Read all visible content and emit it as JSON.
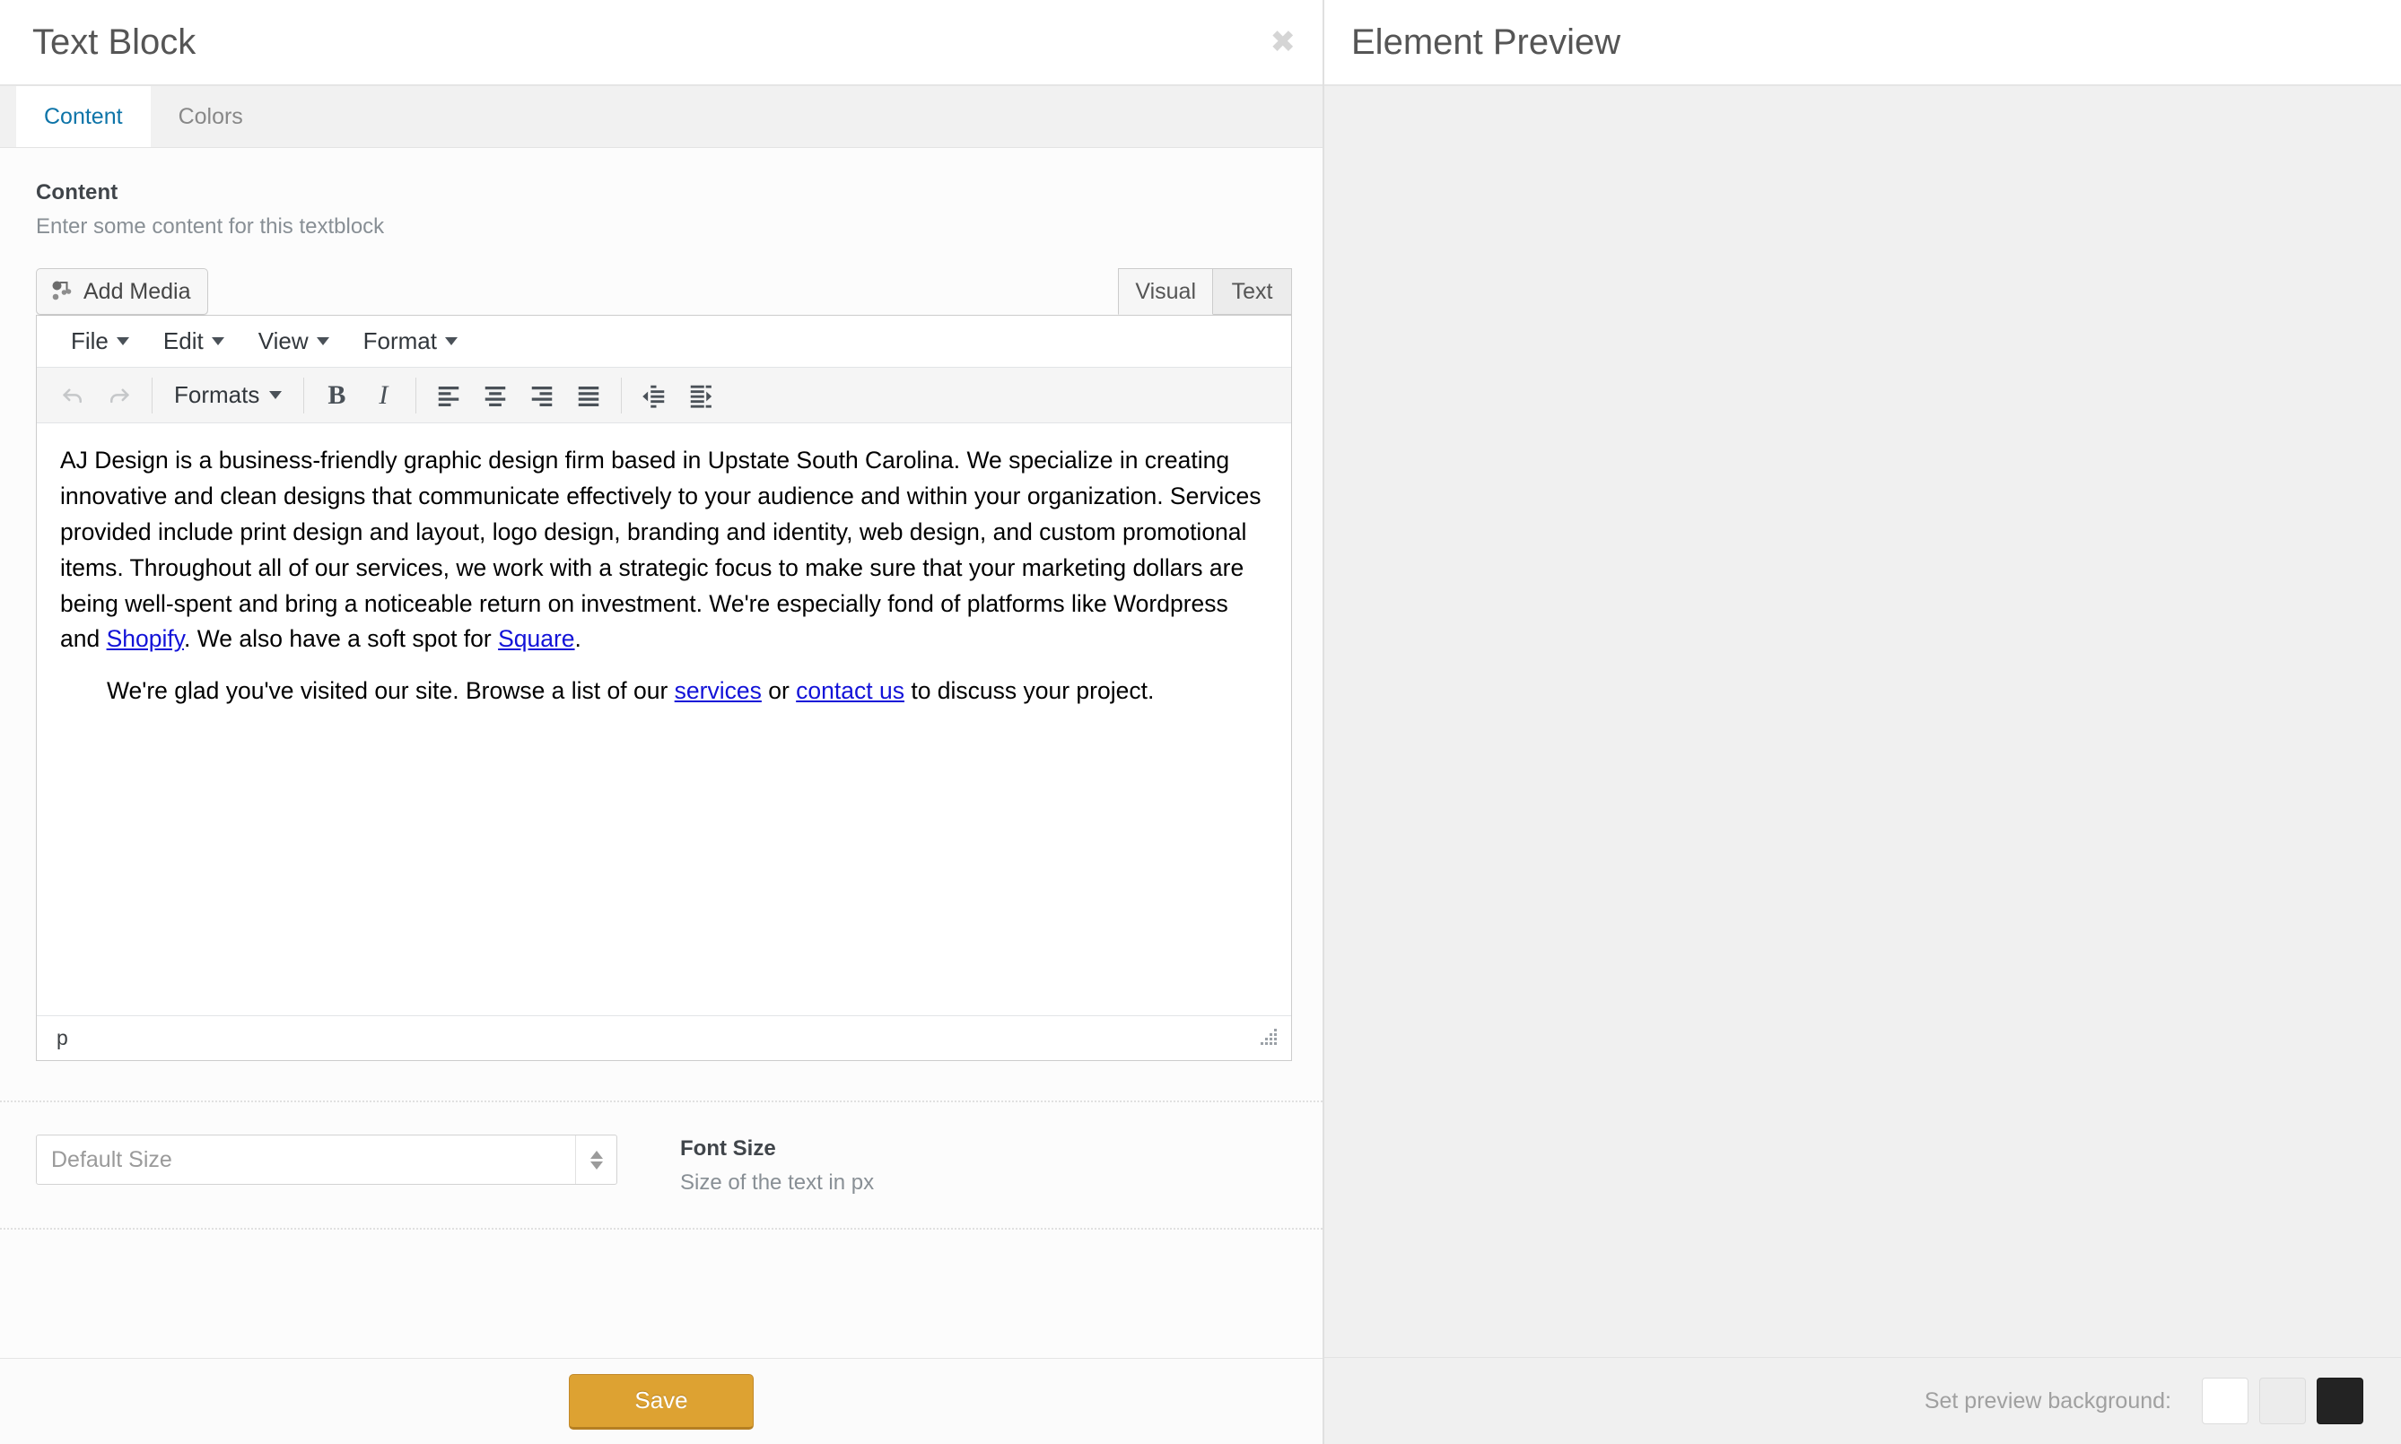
{
  "modal": {
    "title": "Text Block",
    "close_icon": "close-icon",
    "tabs": [
      {
        "label": "Content",
        "active": true
      },
      {
        "label": "Colors",
        "active": false
      }
    ]
  },
  "content_section": {
    "label": "Content",
    "description": "Enter some content for this textblock",
    "add_media_label": "Add Media",
    "add_media_icon": "media-icon",
    "editor_mode_tabs": [
      {
        "label": "Visual",
        "active": true
      },
      {
        "label": "Text",
        "active": false
      }
    ],
    "menubar": [
      {
        "label": "File"
      },
      {
        "label": "Edit"
      },
      {
        "label": "View"
      },
      {
        "label": "Format"
      }
    ],
    "toolbar": {
      "undo_icon": "undo-icon",
      "redo_icon": "redo-icon",
      "formats_label": "Formats",
      "bold_label": "B",
      "italic_label": "I",
      "align_left_icon": "align-left-icon",
      "align_center_icon": "align-center-icon",
      "align_right_icon": "align-right-icon",
      "align_justify_icon": "align-justify-icon",
      "outdent_icon": "outdent-icon",
      "indent_icon": "indent-icon"
    },
    "editor": {
      "paragraph1_part1": "AJ Design is a business-friendly graphic design firm based in Upstate South Carolina. We specialize in creating innovative and clean designs that communicate effectively to your audience and within your organization. Services provided include print design and layout, logo design, branding and identity, web design, and custom promotional items. Throughout all of our services, we work with a strategic focus to make sure that your marketing dollars are being well-spent and bring a noticeable return on investment. We're especially fond of platforms like Wordpress and ",
      "link_shopify": "Shopify",
      "paragraph1_part2": ". We also have a soft spot for ",
      "link_square": "Square",
      "paragraph1_part3": ".",
      "quote_part1": "We're glad you've visited our site. Browse a list of  our ",
      "link_services": "services",
      "quote_part2": " or ",
      "link_contact": "contact us",
      "quote_part3": " to discuss your project."
    },
    "statusbar_path": "p"
  },
  "font_size_section": {
    "input_placeholder": "Default Size",
    "input_value": "",
    "title": "Font Size",
    "description": "Size of the text in px"
  },
  "footer": {
    "save_label": "Save"
  },
  "preview": {
    "title": "Element Preview",
    "background_label": "Set preview background:",
    "swatches": [
      {
        "name": "white",
        "color": "#ffffff"
      },
      {
        "name": "light-gray",
        "color": "#ececec"
      },
      {
        "name": "black",
        "color": "#232323"
      }
    ]
  },
  "colors": {
    "accent_blue": "#0d74a8",
    "link_blue": "#1212d8",
    "save_gold": "#dda232",
    "preview_bg": "#f0f0f0"
  }
}
